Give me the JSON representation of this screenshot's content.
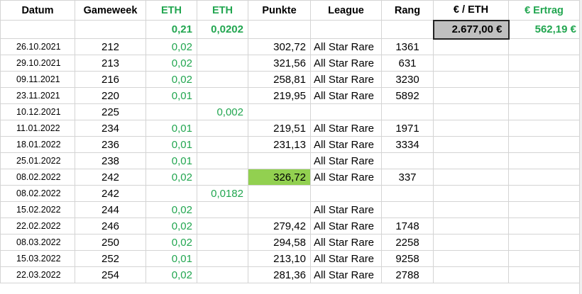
{
  "headers": {
    "datum": "Datum",
    "gameweek": "Gameweek",
    "eth1": "ETH",
    "eth2": "ETH",
    "punkte": "Punkte",
    "league": "League",
    "rang": "Rang",
    "eur_eth": "€ / ETH",
    "ertrag": "€ Ertrag"
  },
  "totals": {
    "eth1": "0,21",
    "eth2": "0,0202",
    "eur_eth": "2.677,00 €",
    "ertrag": "562,19 €"
  },
  "rows": [
    {
      "datum": "26.10.2021",
      "gameweek": "212",
      "eth1": "0,02",
      "eth2": "",
      "punkte": "302,72",
      "league": "All Star Rare",
      "rang": "1361"
    },
    {
      "datum": "29.10.2021",
      "gameweek": "213",
      "eth1": "0,02",
      "eth2": "",
      "punkte": "321,56",
      "league": "All Star Rare",
      "rang": "631"
    },
    {
      "datum": "09.11.2021",
      "gameweek": "216",
      "eth1": "0,02",
      "eth2": "",
      "punkte": "258,81",
      "league": "All Star Rare",
      "rang": "3230"
    },
    {
      "datum": "23.11.2021",
      "gameweek": "220",
      "eth1": "0,01",
      "eth2": "",
      "punkte": "219,95",
      "league": "All Star Rare",
      "rang": "5892"
    },
    {
      "datum": "10.12.2021",
      "gameweek": "225",
      "eth1": "",
      "eth2": "0,002",
      "punkte": "",
      "league": "",
      "rang": ""
    },
    {
      "datum": "11.01.2022",
      "gameweek": "234",
      "eth1": "0,01",
      "eth2": "",
      "punkte": "219,51",
      "league": "All Star Rare",
      "rang": "1971"
    },
    {
      "datum": "18.01.2022",
      "gameweek": "236",
      "eth1": "0,01",
      "eth2": "",
      "punkte": "231,13",
      "league": "All Star Rare",
      "rang": "3334"
    },
    {
      "datum": "25.01.2022",
      "gameweek": "238",
      "eth1": "0,01",
      "eth2": "",
      "punkte": "",
      "league": "All Star Rare",
      "rang": ""
    },
    {
      "datum": "08.02.2022",
      "gameweek": "242",
      "eth1": "0,02",
      "eth2": "",
      "punkte": "326,72",
      "league": "All Star Rare",
      "rang": "337"
    },
    {
      "datum": "08.02.2022",
      "gameweek": "242",
      "eth1": "",
      "eth2": "0,0182",
      "punkte": "",
      "league": "",
      "rang": ""
    },
    {
      "datum": "15.02.2022",
      "gameweek": "244",
      "eth1": "0,02",
      "eth2": "",
      "punkte": "",
      "league": "All Star Rare",
      "rang": ""
    },
    {
      "datum": "22.02.2022",
      "gameweek": "246",
      "eth1": "0,02",
      "eth2": "",
      "punkte": "279,42",
      "league": "All Star Rare",
      "rang": "1748"
    },
    {
      "datum": "08.03.2022",
      "gameweek": "250",
      "eth1": "0,02",
      "eth2": "",
      "punkte": "294,58",
      "league": "All Star Rare",
      "rang": "2258"
    },
    {
      "datum": "15.03.2022",
      "gameweek": "252",
      "eth1": "0,01",
      "eth2": "",
      "punkte": "213,10",
      "league": "All Star Rare",
      "rang": "9258"
    },
    {
      "datum": "22.03.2022",
      "gameweek": "254",
      "eth1": "0,02",
      "eth2": "",
      "punkte": "281,36",
      "league": "All Star Rare",
      "rang": "2788"
    }
  ],
  "colors": {
    "green_text": "#22a650",
    "highlight_fill": "#92d050",
    "rate_box_fill": "#bfbfbf",
    "grid": "#d4d4d4"
  }
}
